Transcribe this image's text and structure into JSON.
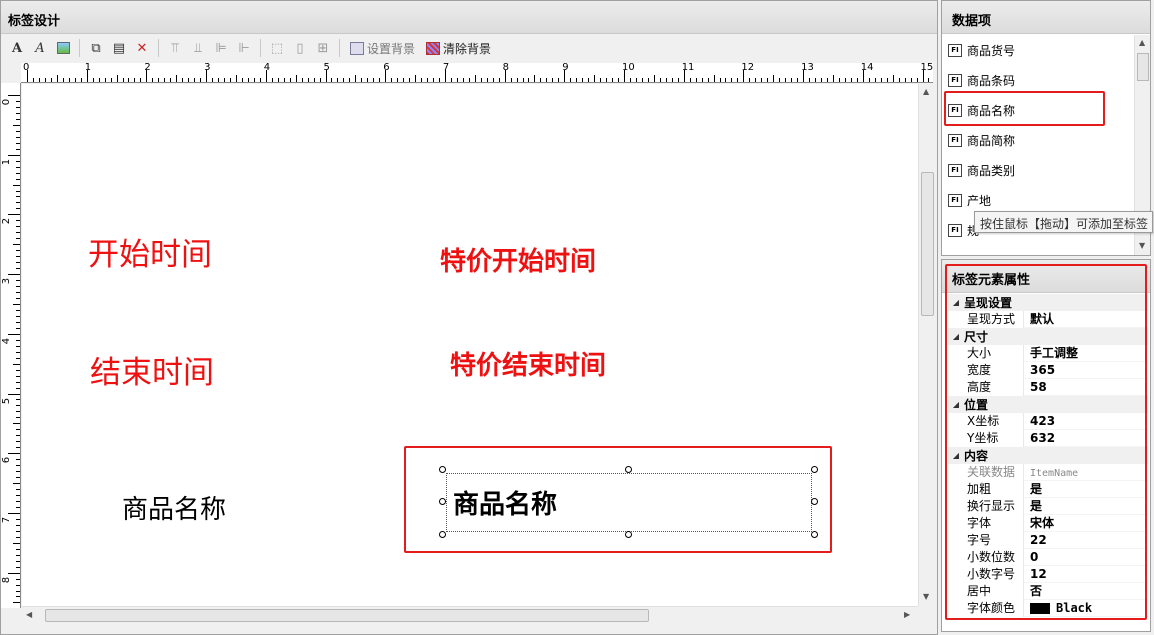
{
  "designer": {
    "title": "标签设计",
    "toolbar": {
      "set_background": "设置背景",
      "clear_background": "清除背景"
    },
    "ruler_top_labels": [
      "0",
      "1",
      "2",
      "3",
      "4",
      "5",
      "6",
      "7",
      "8",
      "9",
      "10",
      "11",
      "12",
      "13",
      "14",
      "15"
    ],
    "ruler_left_labels": [
      "0",
      "1",
      "2",
      "3",
      "4",
      "5",
      "6",
      "7",
      "8"
    ],
    "canvas": {
      "start_time_label": "开始时间",
      "special_start_label": "特价开始时间",
      "end_time_label": "结束时间",
      "special_end_label": "特价结束时间",
      "product_name_label": "商品名称",
      "product_name_field": "商品名称"
    }
  },
  "data_panel": {
    "title": "数据项",
    "items": [
      "商品货号",
      "商品条码",
      "商品名称",
      "商品简称",
      "商品类别",
      "产地",
      "规"
    ],
    "tooltip": "按住鼠标【拖动】可添加至标签"
  },
  "prop_panel": {
    "title": "标签元素属性",
    "rows": [
      {
        "type": "cat",
        "key": "呈现设置"
      },
      {
        "type": "prop",
        "key": "呈现方式",
        "value": "默认"
      },
      {
        "type": "cat",
        "key": "尺寸"
      },
      {
        "type": "prop",
        "key": "大小",
        "value": "手工调整"
      },
      {
        "type": "prop",
        "key": "宽度",
        "value": "365"
      },
      {
        "type": "prop",
        "key": "高度",
        "value": "58"
      },
      {
        "type": "cat",
        "key": "位置"
      },
      {
        "type": "prop",
        "key": "X坐标",
        "value": "423"
      },
      {
        "type": "prop",
        "key": "Y坐标",
        "value": "632"
      },
      {
        "type": "cat",
        "key": "内容"
      },
      {
        "type": "prop",
        "key": "关联数据",
        "value": "ItemName",
        "grey": true
      },
      {
        "type": "prop",
        "key": "加粗",
        "value": "是"
      },
      {
        "type": "prop",
        "key": "换行显示",
        "value": "是"
      },
      {
        "type": "prop",
        "key": "字体",
        "value": "宋体"
      },
      {
        "type": "prop",
        "key": "字号",
        "value": "22"
      },
      {
        "type": "prop",
        "key": "小数位数",
        "value": "0"
      },
      {
        "type": "prop",
        "key": "小数字号",
        "value": "12"
      },
      {
        "type": "prop",
        "key": "居中",
        "value": "否"
      },
      {
        "type": "prop",
        "key": "字体颜色",
        "value": "Black",
        "swatch": "#000000"
      }
    ]
  },
  "colors": {
    "highlight": "#e41c1c",
    "canvas_label": "#ee1111"
  }
}
